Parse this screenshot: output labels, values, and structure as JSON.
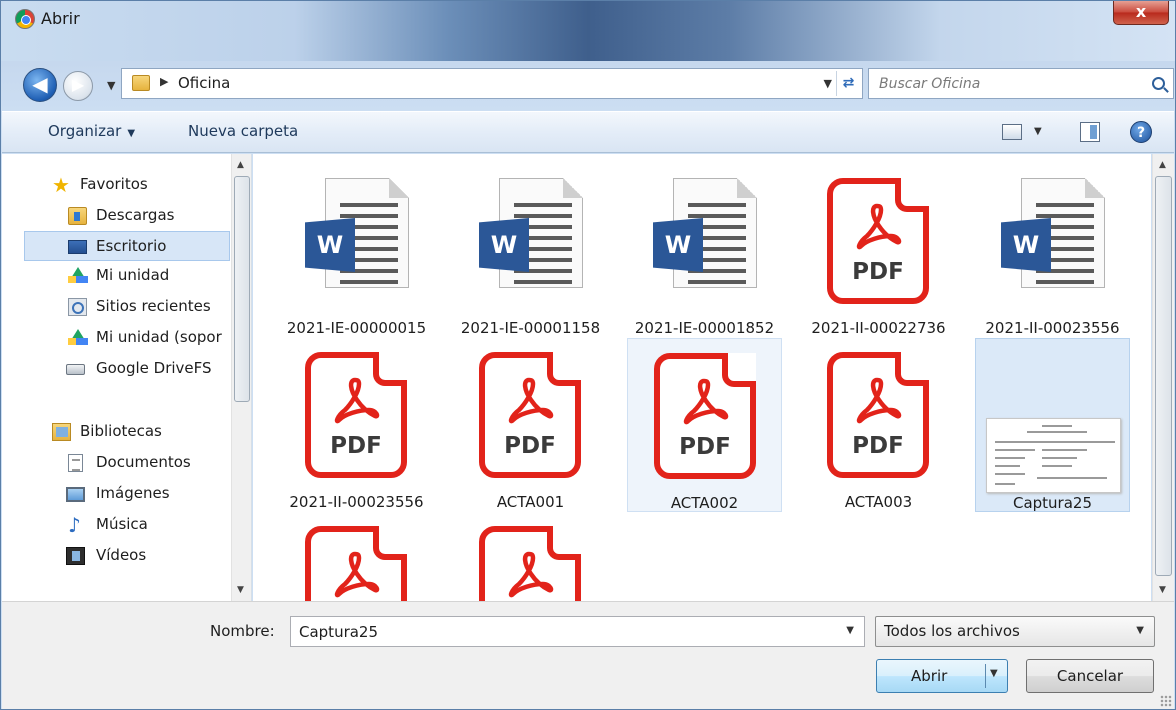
{
  "window": {
    "title": "Abrir",
    "close_label": "x"
  },
  "address": {
    "path_segment": "Oficina"
  },
  "search": {
    "placeholder": "Buscar Oficina"
  },
  "toolbar": {
    "organize_label": "Organizar",
    "new_folder_label": "Nueva carpeta",
    "help_label": "?"
  },
  "navigation": {
    "favorites": "Favoritos",
    "items": [
      "Descargas",
      "Escritorio",
      "Mi unidad",
      "Sitios recientes",
      "Mi unidad (sopor",
      "Google DriveFS"
    ],
    "libraries": "Bibliotecas",
    "library_items": [
      "Documentos",
      "Imágenes",
      "Música",
      "Vídeos"
    ],
    "selected": "Escritorio"
  },
  "files": [
    {
      "name": "2021-IE-00000015",
      "type": "word"
    },
    {
      "name": "2021-IE-00001158",
      "type": "word"
    },
    {
      "name": "2021-IE-00001852",
      "type": "word"
    },
    {
      "name": "2021-II-00022736",
      "type": "pdf"
    },
    {
      "name": "2021-II-00023556",
      "type": "word"
    },
    {
      "name": "2021-II-00023556",
      "type": "pdf"
    },
    {
      "name": "ACTA001",
      "type": "pdf"
    },
    {
      "name": "ACTA002",
      "type": "pdf"
    },
    {
      "name": "ACTA003",
      "type": "pdf"
    },
    {
      "name": "Captura25",
      "type": "image",
      "selected": true
    },
    {
      "name": "",
      "type": "pdf"
    },
    {
      "name": "",
      "type": "pdf"
    }
  ],
  "pdf_label": "PDF",
  "word_label": "W",
  "footer": {
    "name_label": "Nombre:",
    "name_value": "Captura25",
    "file_type": "Todos los archivos",
    "open_label": "Abrir",
    "cancel_label": "Cancelar"
  },
  "colors": {
    "pdf_red": "#e2231a",
    "word_blue": "#2b5797",
    "selection": "#dbe9f8"
  }
}
